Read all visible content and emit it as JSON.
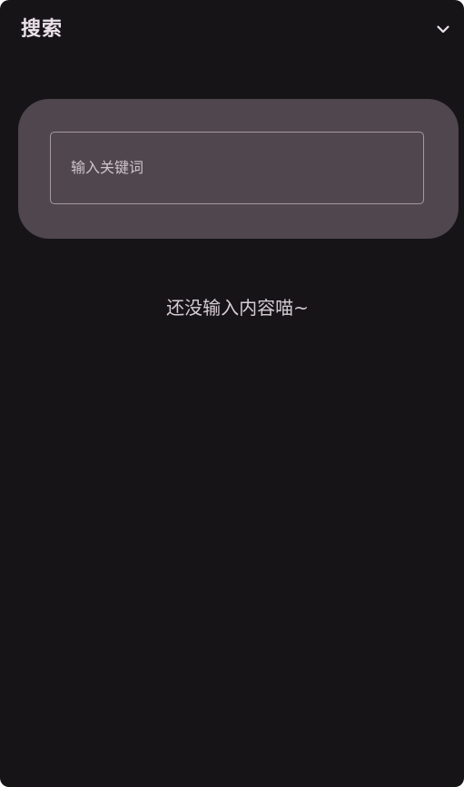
{
  "header": {
    "title": "搜索",
    "collapse_icon": "chevron-down-icon"
  },
  "search": {
    "placeholder": "输入关键词",
    "value": ""
  },
  "main": {
    "empty_message": "还没输入内容喵~"
  },
  "colors": {
    "panel_background": "#171417",
    "card_background": "#4f464e",
    "field_border": "#a59aa3",
    "text_primary": "#ece3ea"
  }
}
